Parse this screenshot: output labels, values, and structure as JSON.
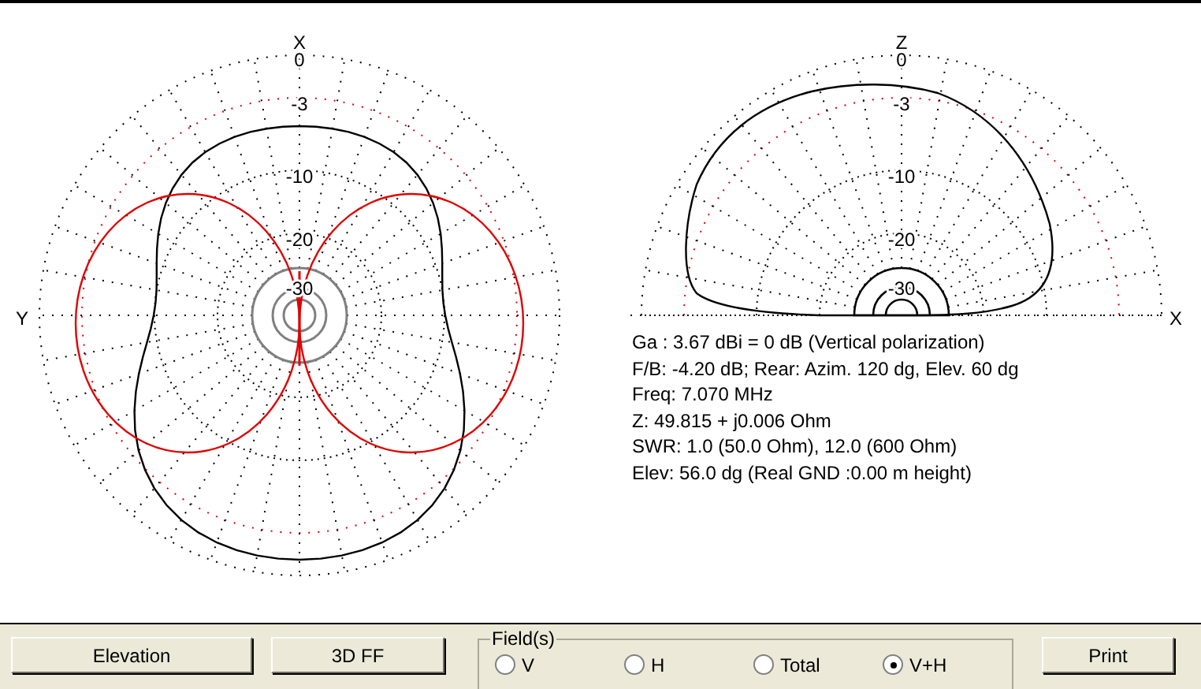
{
  "left_plot": {
    "top_axis": "X",
    "left_axis": "Y",
    "ring_labels": [
      "0",
      "-3",
      "-10",
      "-20",
      "-30"
    ]
  },
  "right_plot": {
    "top_axis": "Z",
    "right_axis": "X",
    "ring_labels": [
      "0",
      "-3",
      "-10",
      "-20",
      "-30"
    ]
  },
  "info_lines": [
    "Ga : 3.67 dBi = 0 dB  (Vertical polarization)",
    "F/B: -4.20 dB; Rear: Azim. 120 dg,  Elev. 60 dg",
    "Freq: 7.070 MHz",
    "Z: 49.815 + j0.006 Ohm",
    "SWR: 1.0 (50.0 Ohm), 12.0 (600 Ohm)",
    "Elev: 56.0 dg (Real GND  :0.00 m height)"
  ],
  "buttons": [
    "Elevation",
    "3D FF"
  ],
  "fields": {
    "legend": "Field(s)",
    "options": [
      {
        "label": "V",
        "selected": false
      },
      {
        "label": "H",
        "selected": false
      },
      {
        "label": "Total",
        "selected": false
      },
      {
        "label": "V+H",
        "selected": true
      }
    ]
  },
  "print_button": "Print"
}
